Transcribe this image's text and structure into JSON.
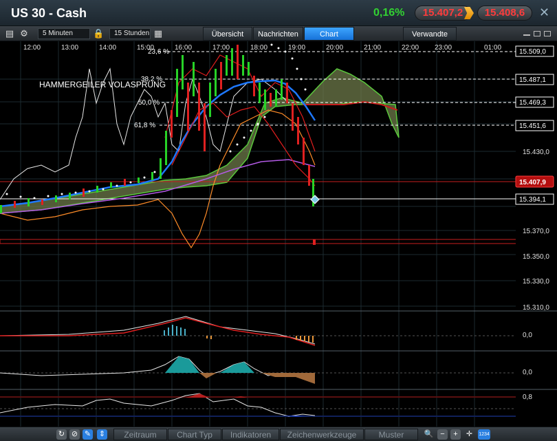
{
  "header": {
    "title": "US 30 - Cash",
    "change": "0,16%",
    "bid": "15.407,2",
    "ask": "15.408,6",
    "close": "✕",
    "colors": {
      "change": "#32d232",
      "price": "#ff3c3c",
      "accent": "#1672d8"
    }
  },
  "toolbar": {
    "interval": "5 Minuten",
    "range": "15 Stunden",
    "tabs": [
      "Übersicht",
      "Nachrichten",
      "Chart"
    ],
    "active_tab": "Chart",
    "related": "Verwandte"
  },
  "chart": {
    "time_labels": [
      "12:00",
      "13:00",
      "14:00",
      "15:00",
      "16:00",
      "17:00",
      "18:00",
      "19:00",
      "20:00",
      "21:00",
      "22:00",
      "23:00",
      "01:00"
    ],
    "price_axis": [
      "15.430,0",
      "15.370,0",
      "15.350,0",
      "15.330,0",
      "15.310,0"
    ],
    "boxed_levels": [
      {
        "label": "15.509,0",
        "style": "white"
      },
      {
        "label": "15.487,1",
        "style": "white"
      },
      {
        "label": "15.469,3",
        "style": "white"
      },
      {
        "label": "15.451,6",
        "style": "white"
      },
      {
        "label": "15.407,9",
        "style": "red"
      },
      {
        "label": "15.394,1",
        "style": "white"
      }
    ],
    "fib_labels": [
      "23,6 %",
      "38,2 %",
      "50,0 %",
      "61,8 %"
    ],
    "annotation": "HAMMERGEILER VOLASPRUNG",
    "indicator_axis": [
      "0,0",
      "0,0",
      "0,8"
    ]
  },
  "bottombar": {
    "tabs": [
      "Zeitraum",
      "Chart Typ",
      "Indikatoren",
      "Zeichenwerkzeuge",
      "Muster"
    ],
    "badge": "1234"
  }
}
